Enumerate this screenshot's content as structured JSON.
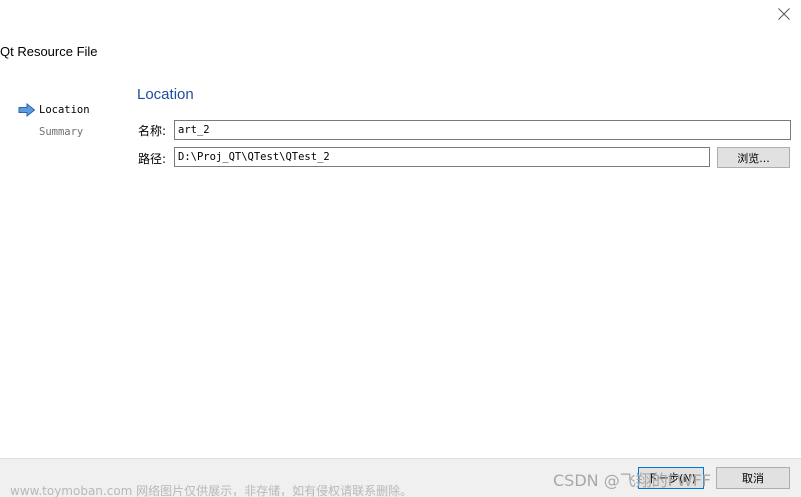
{
  "window": {
    "title": "Qt Resource File",
    "close_icon": "close-icon"
  },
  "steps": [
    {
      "label": "Location",
      "active": true,
      "icon": "arrow-right-icon"
    },
    {
      "label": "Summary",
      "active": false
    }
  ],
  "page": {
    "title": "Location"
  },
  "form": {
    "name_label": "名称:",
    "name_value": "art_2",
    "path_label": "路径:",
    "path_value": "D:\\Proj_QT\\QTest\\QTest_2",
    "browse_label": "浏览..."
  },
  "footer": {
    "next_label": "下一步(N)",
    "cancel_label": "取消",
    "watermark": "www.toymoban.com 网络图片仅供展示，非存储，如有侵权请联系删除。",
    "csdn_mark": "CSDN @飞翔的FWFF"
  },
  "colors": {
    "accent": "#1c4d9c",
    "arrow": "#3b7fd6",
    "footer_bg": "#f0f0f0"
  }
}
